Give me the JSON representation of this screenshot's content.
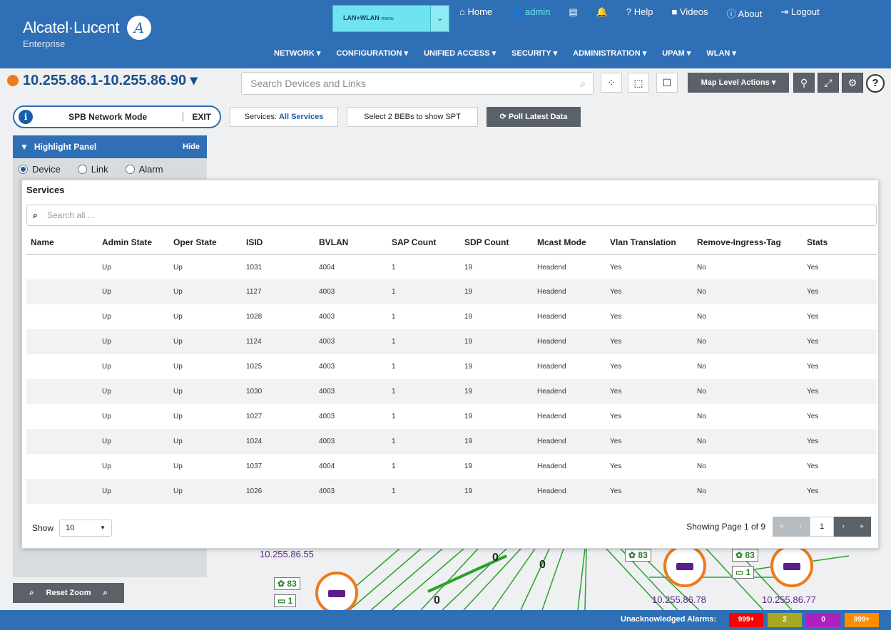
{
  "header": {
    "brand": "Alcatel·Lucent",
    "brand_sub": "Enterprise",
    "brand_mark": "A",
    "lanwlan_label": "LAN+WLAN",
    "lanwlan_sub": "menu",
    "top_links": [
      "Home",
      "admin",
      "Videos",
      "Help",
      "About",
      "Logout"
    ],
    "nav": [
      "NETWORK ▾",
      "CONFIGURATION ▾",
      "UNIFIED ACCESS ▾",
      "SECURITY ▾",
      "ADMINISTRATION ▾",
      "UPAM ▾",
      "WLAN ▾"
    ]
  },
  "toolbar": {
    "ip_range": "10.255.86.1-10.255.86.90 ▾",
    "search_placeholder": "Search Devices and Links",
    "map_level_actions": "Map Level Actions ▾",
    "help": "?"
  },
  "mode_bar": {
    "mode_label": "SPB Network Mode",
    "exit_label": "EXIT",
    "services_prefix": "Services:",
    "services_value": "All Services",
    "select_bebs": "Select 2 BEBs to show SPT",
    "poll_label": "Poll Latest Data"
  },
  "highlight_panel": {
    "title": "Highlight Panel",
    "hide": "Hide",
    "radios": [
      "Device",
      "Link",
      "Alarm"
    ],
    "selected": "Device",
    "reset_zoom": "Reset Zoom"
  },
  "services": {
    "title": "Services",
    "search_placeholder": "Search all ...",
    "columns": [
      "Name",
      "Admin State",
      "Oper State",
      "ISID",
      "BVLAN",
      "SAP Count",
      "SDP Count",
      "Mcast Mode",
      "Vlan Translation",
      "Remove-Ingress-Tag",
      "Stats"
    ],
    "rows": [
      [
        "",
        "Up",
        "Up",
        "1031",
        "4004",
        "1",
        "19",
        "Headend",
        "Yes",
        "No",
        "Yes"
      ],
      [
        "",
        "Up",
        "Up",
        "1127",
        "4003",
        "1",
        "19",
        "Headend",
        "Yes",
        "No",
        "Yes"
      ],
      [
        "",
        "Up",
        "Up",
        "1028",
        "4003",
        "1",
        "19",
        "Headend",
        "Yes",
        "No",
        "Yes"
      ],
      [
        "",
        "Up",
        "Up",
        "1124",
        "4003",
        "1",
        "19",
        "Headend",
        "Yes",
        "No",
        "Yes"
      ],
      [
        "",
        "Up",
        "Up",
        "1025",
        "4003",
        "1",
        "19",
        "Headend",
        "Yes",
        "No",
        "Yes"
      ],
      [
        "",
        "Up",
        "Up",
        "1030",
        "4003",
        "1",
        "19",
        "Headend",
        "Yes",
        "No",
        "Yes"
      ],
      [
        "",
        "Up",
        "Up",
        "1027",
        "4003",
        "1",
        "19",
        "Headend",
        "Yes",
        "No",
        "Yes"
      ],
      [
        "",
        "Up",
        "Up",
        "1024",
        "4003",
        "1",
        "19",
        "Headend",
        "Yes",
        "No",
        "Yes"
      ],
      [
        "",
        "Up",
        "Up",
        "1037",
        "4004",
        "1",
        "19",
        "Headend",
        "Yes",
        "No",
        "Yes"
      ],
      [
        "",
        "Up",
        "Up",
        "1026",
        "4003",
        "1",
        "19",
        "Headend",
        "Yes",
        "No",
        "Yes"
      ]
    ],
    "show_label": "Show",
    "page_size": "10",
    "page_info": "Showing Page 1 of 9",
    "current_page": "1"
  },
  "map": {
    "ip_left": "10.255.86.55",
    "ip_mid": "10.255.86.78",
    "ip_right": "10.255.86.77",
    "badge_count": "83",
    "badge_one": "1",
    "edge_labels": [
      "0",
      "0",
      "0"
    ]
  },
  "footer": {
    "alarms_label": "Unacknowledged Alarms:",
    "alarms": [
      {
        "value": "999+",
        "color": "#ff0000"
      },
      {
        "value": "2",
        "color": "#a8a820"
      },
      {
        "value": "0",
        "color": "#b020c0"
      },
      {
        "value": "999+",
        "color": "#ff8c00"
      }
    ]
  },
  "colors": {
    "brand_blue": "#2f6fb5",
    "accent_cyan": "#6fe3f0",
    "orange": "#ef7a1a",
    "dark_button": "#5a6169",
    "link_green": "#2ca02c"
  }
}
